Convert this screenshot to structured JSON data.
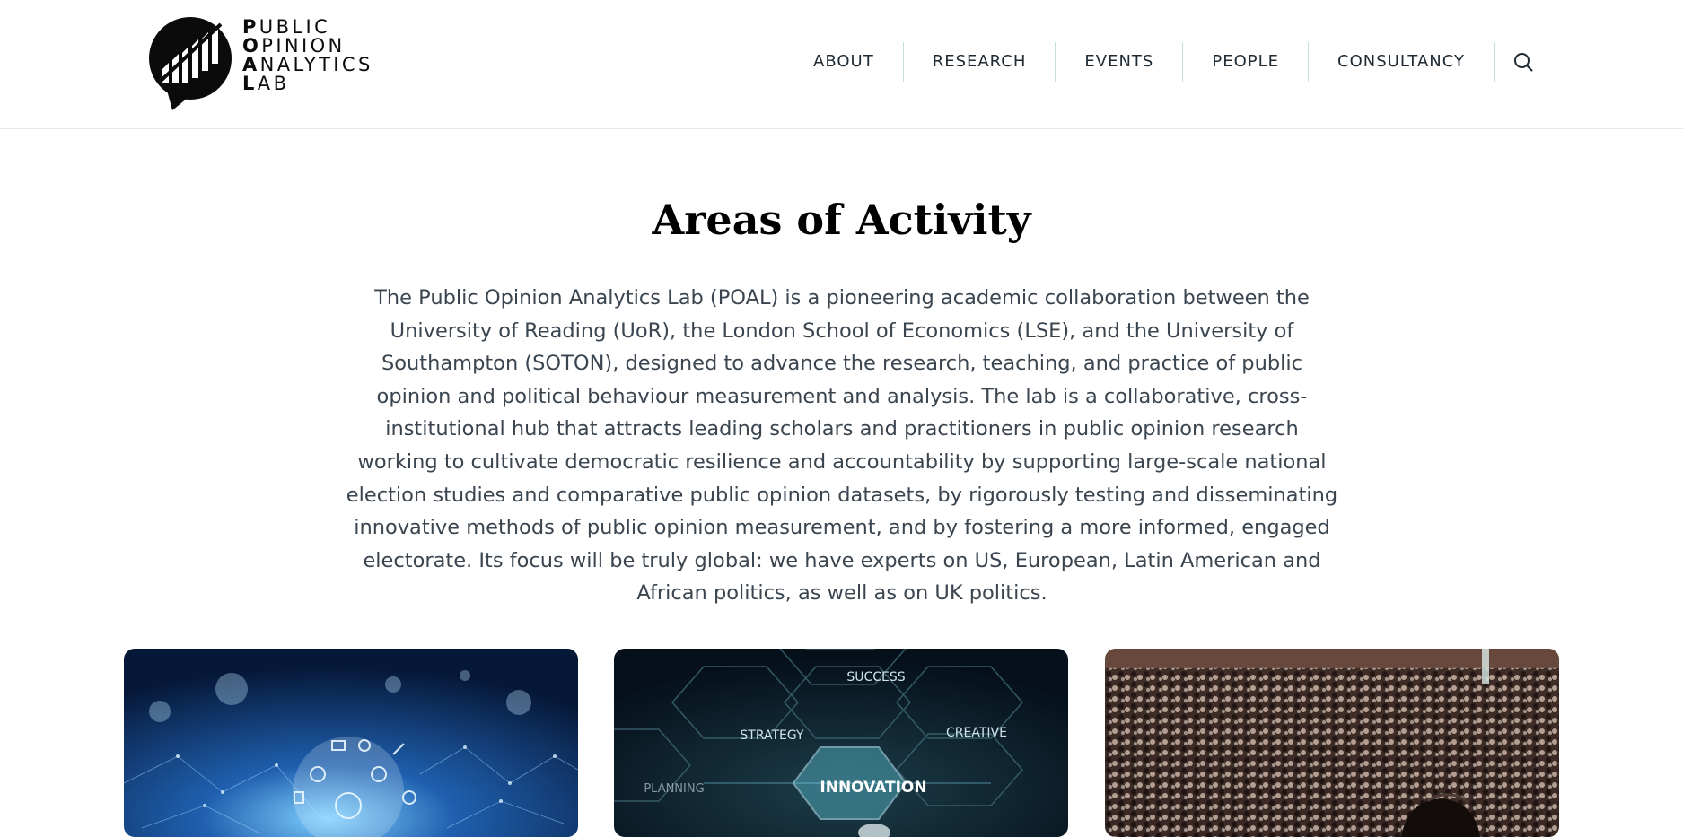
{
  "brand": {
    "lines": [
      {
        "initial": "P",
        "rest": "UBLIC"
      },
      {
        "initial": "O",
        "rest": "PINION"
      },
      {
        "initial": "A",
        "rest": "NALYTICS"
      },
      {
        "initial": "L",
        "rest": "AB"
      }
    ]
  },
  "nav": {
    "items": [
      "ABOUT",
      "RESEARCH",
      "EVENTS",
      "PEOPLE",
      "CONSULTANCY"
    ],
    "search_icon": "search-icon"
  },
  "main": {
    "title": "Areas of Activity",
    "intro": "The Public Opinion Analytics Lab (POAL) is a pioneering academic collaboration between the University of Reading (UoR), the London School of Economics (LSE), and the University of Southampton (SOTON), designed to advance the research, teaching, and practice of public opinion and political behaviour measurement and analysis. The lab is a collaborative, cross-institutional hub that attracts leading scholars and practitioners in public opinion research working to cultivate democratic resilience and accountability by supporting large-scale national election studies and comparative public opinion datasets, by rigorously testing and disseminating innovative methods of public opinion measurement, and by fostering a more informed, engaged electorate. Its focus will be truly global: we have experts on US, European, Latin American and African politics, as well as on UK politics."
  },
  "cards": {
    "innovation": {
      "labels": {
        "success": "SUCCESS",
        "strategy": "STRATEGY",
        "creative": "CREATIVE",
        "planning": "PLANNING",
        "innovation": "INNOVATION"
      }
    }
  },
  "colors": {
    "nav_separator": "#bfe0df",
    "text": "#1f2a33"
  }
}
